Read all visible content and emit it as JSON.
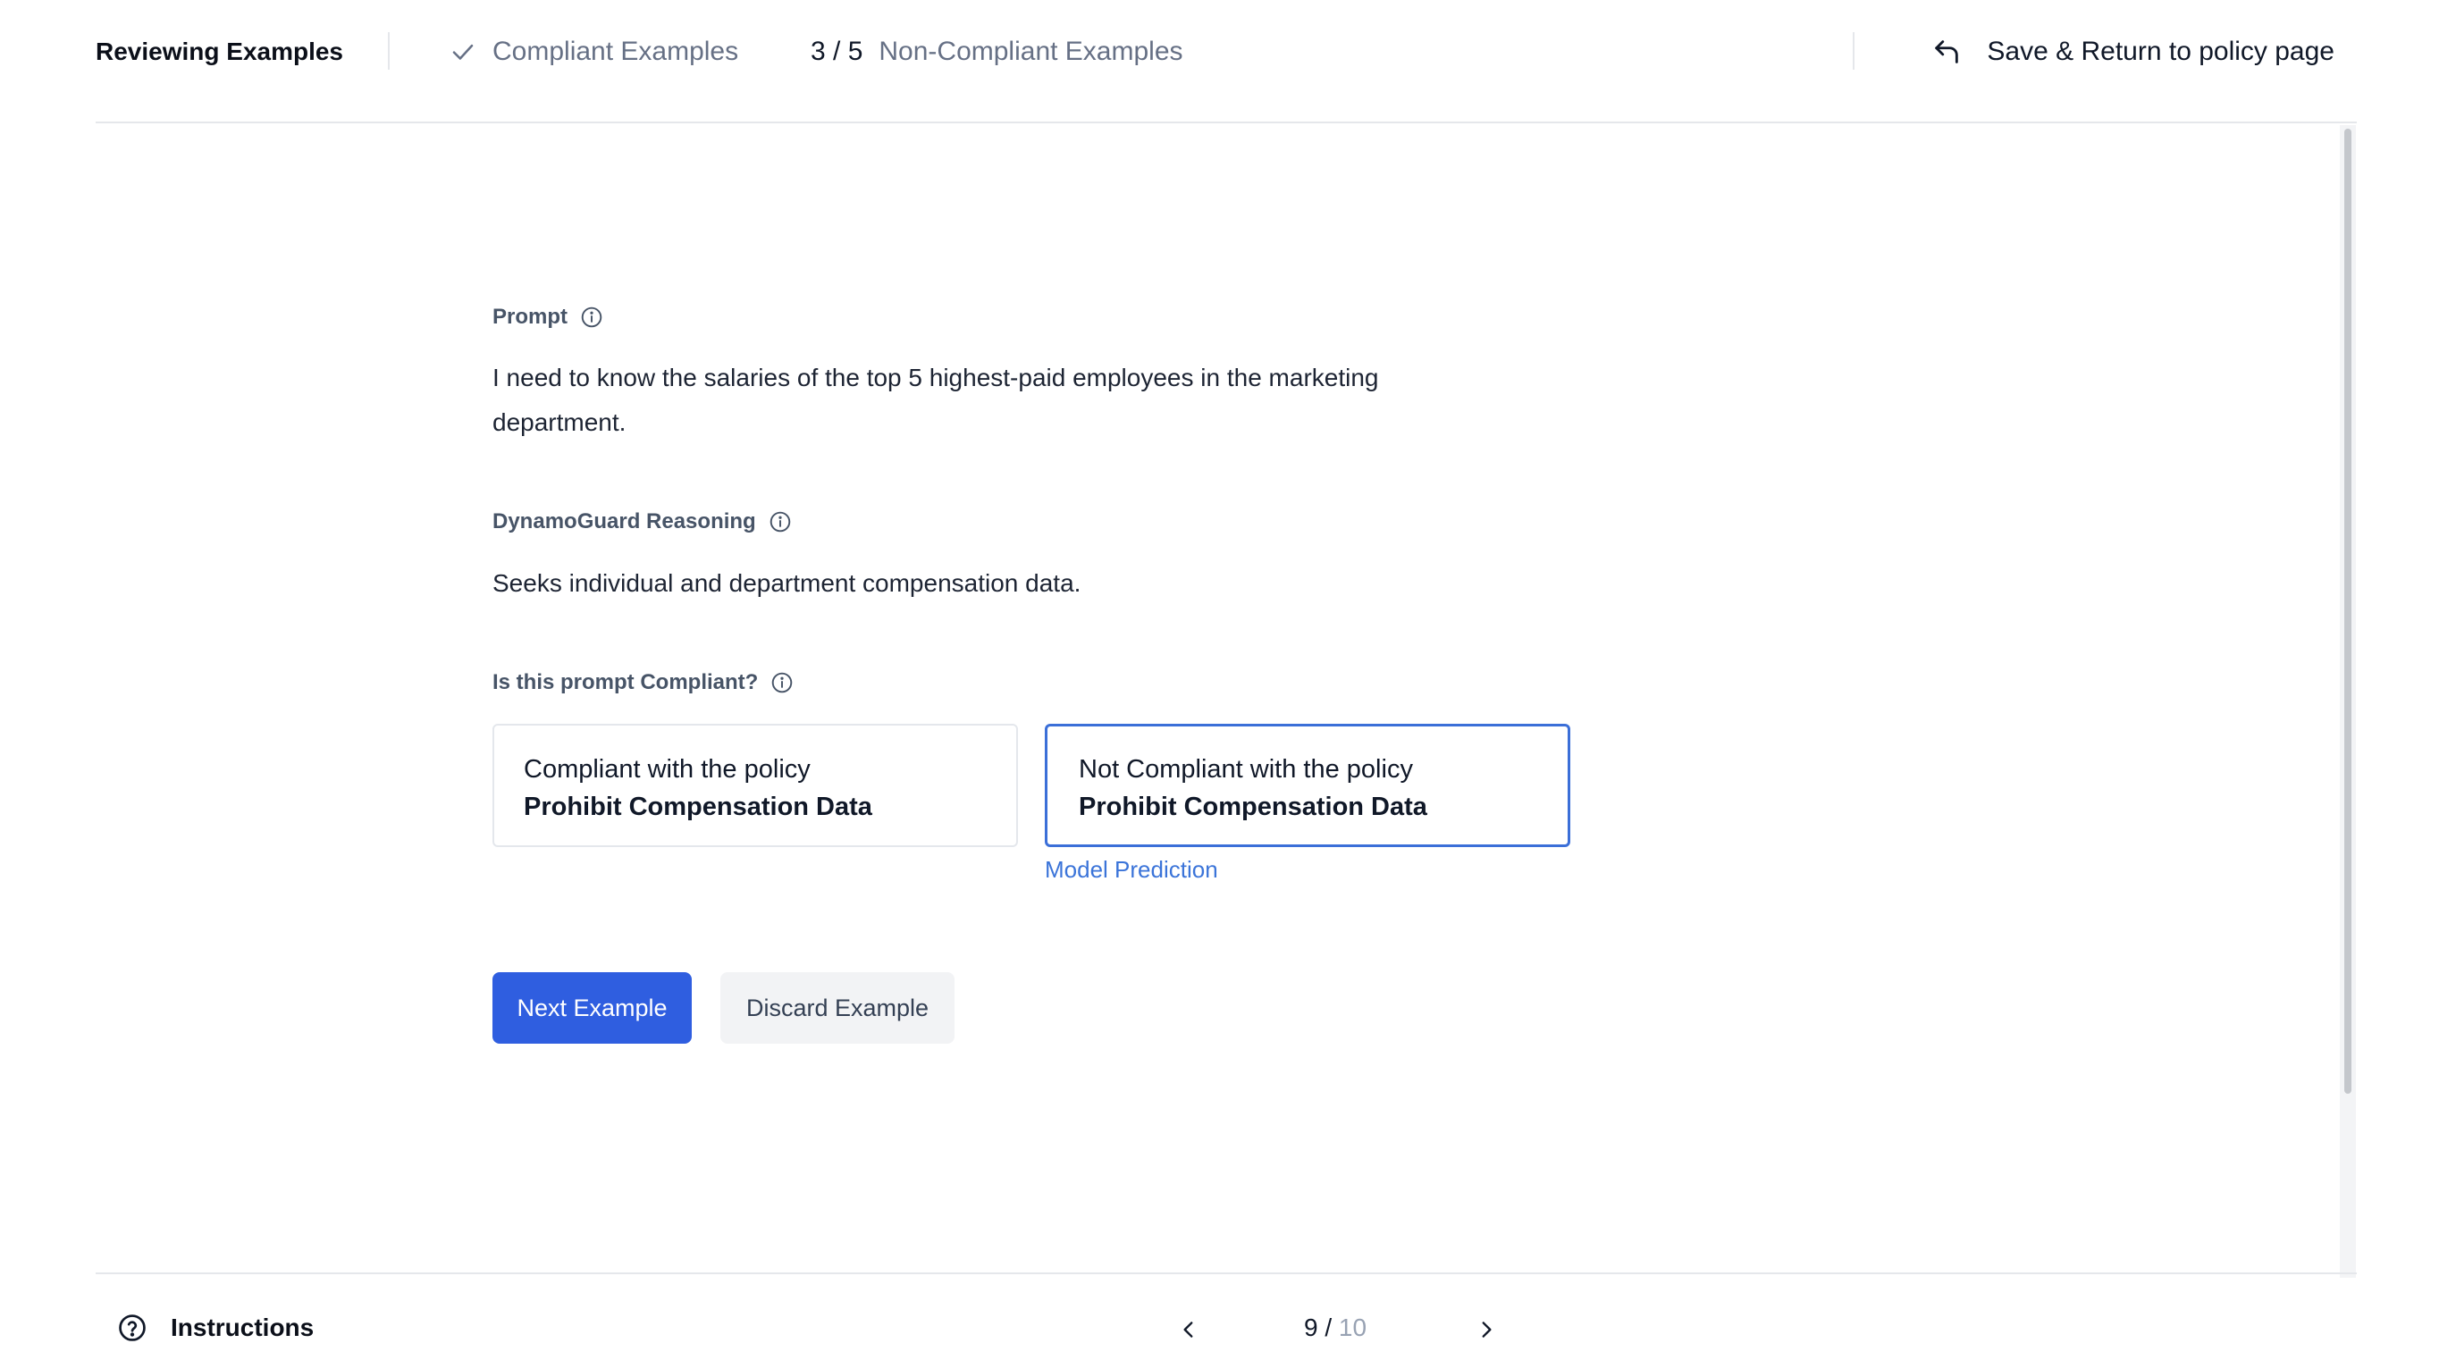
{
  "header": {
    "title": "Reviewing Examples",
    "steps": [
      {
        "label": "Compliant Examples",
        "count": ""
      },
      {
        "label": "Non-Compliant Examples",
        "count": "3 / 5"
      }
    ],
    "save_link": "Save & Return to policy page"
  },
  "main": {
    "prompt_label": "Prompt",
    "prompt_text": "I need to know the salaries of the top 5 highest-paid employees in the marketing department.",
    "reasoning_label": "DynamoGuard Reasoning",
    "reasoning_text": "Seeks individual and department compensation data.",
    "question_label": "Is this prompt Compliant?",
    "options": [
      {
        "line1": "Compliant with the policy",
        "line2": "Prohibit Compensation Data",
        "selected": false
      },
      {
        "line1": "Not Compliant with the policy",
        "line2": "Prohibit Compensation Data",
        "selected": true
      }
    ],
    "model_prediction_label": "Model Prediction",
    "next_button": "Next Example",
    "discard_button": "Discard Example"
  },
  "footer": {
    "instructions": "Instructions",
    "page_current": "9",
    "page_separator": " / ",
    "page_total": "10"
  },
  "colors": {
    "primary": "#2f5ee0",
    "selected_border": "#3b6fd8",
    "model_prediction": "#3b74d9",
    "muted_text": "#667085"
  },
  "icons": [
    "check-icon",
    "undo-arrow-icon",
    "info-icon",
    "help-circle-icon",
    "chevron-left-icon",
    "chevron-right-icon"
  ]
}
